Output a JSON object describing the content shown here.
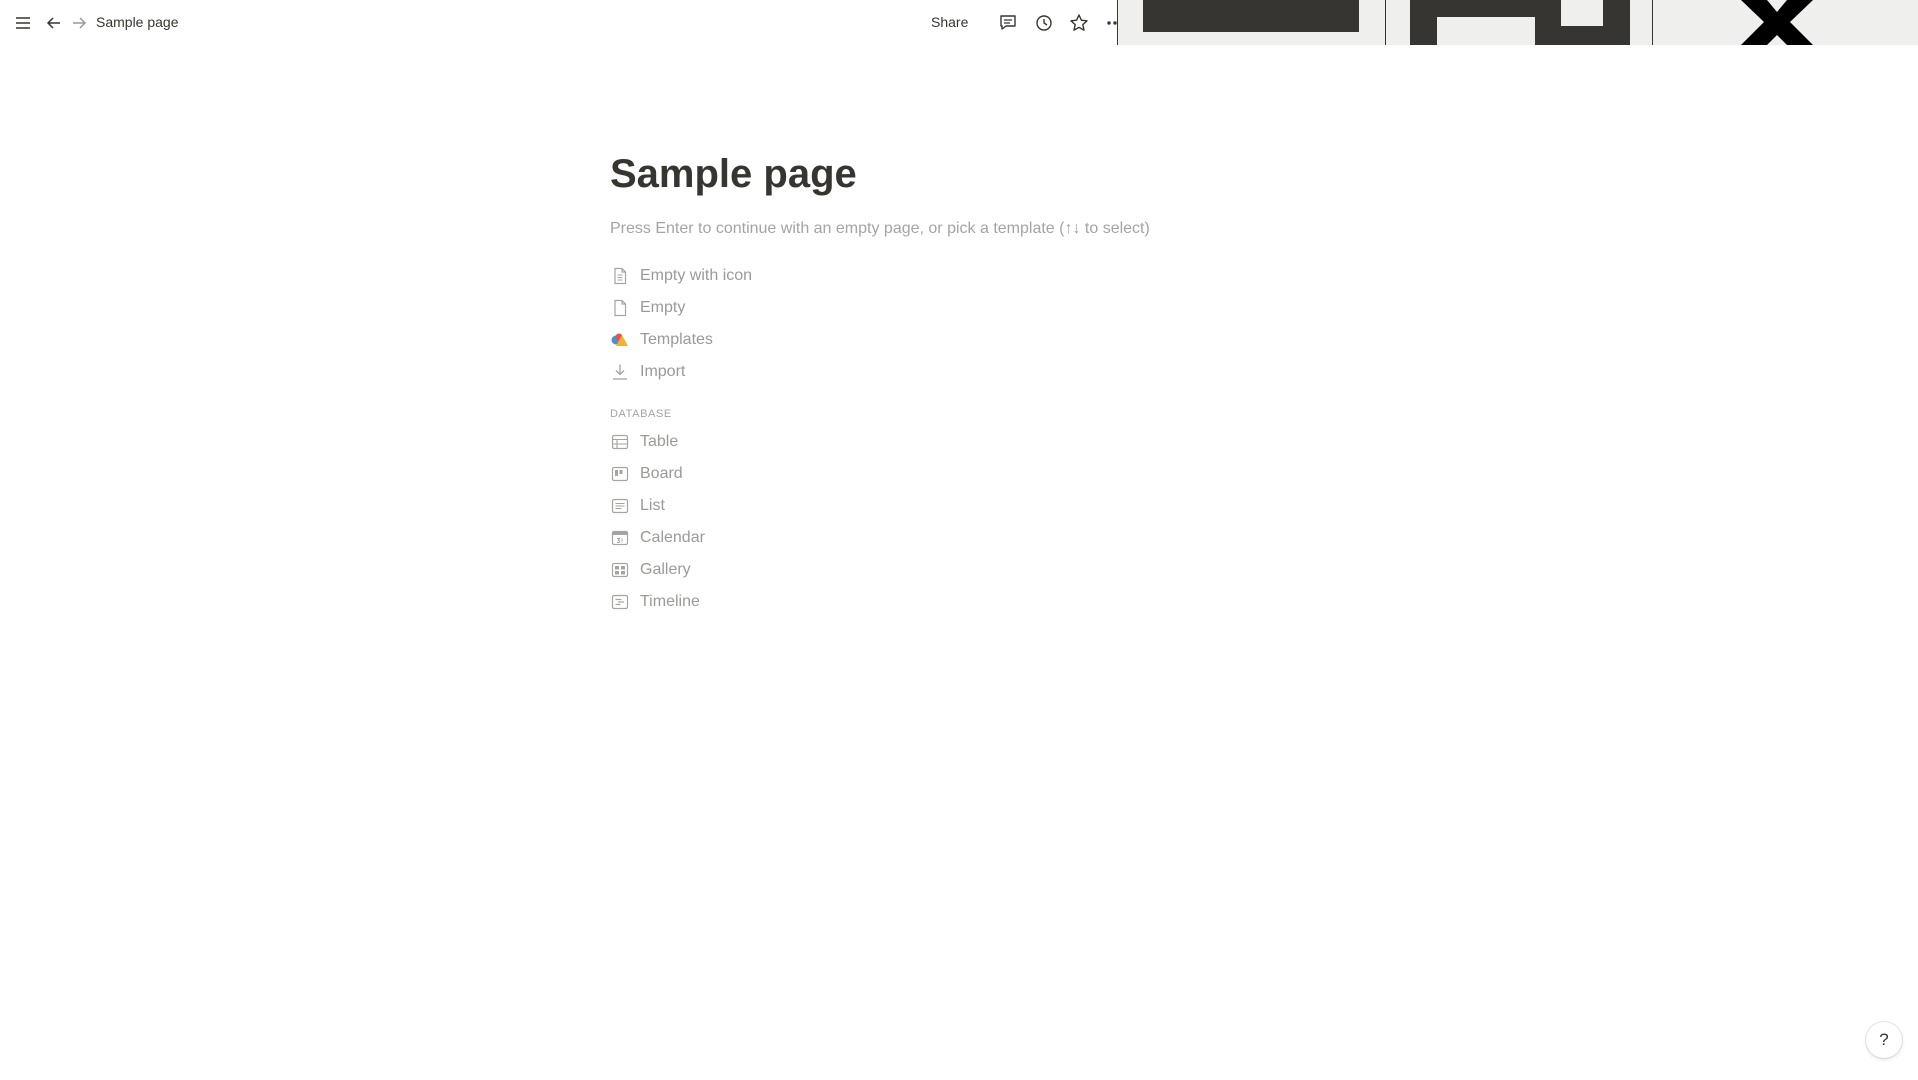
{
  "topbar": {
    "breadcrumb": "Sample page",
    "share_label": "Share",
    "icons": [
      "menu-icon",
      "back-arrow-icon",
      "forward-arrow-icon",
      "comment-icon",
      "history-icon",
      "star-icon",
      "more-icon"
    ]
  },
  "page": {
    "title": "Sample page",
    "hint": "Press Enter to continue with an empty page, or pick a template (↑↓ to select)"
  },
  "options": [
    {
      "label": "Empty with icon",
      "icon": "page-with-icon-icon"
    },
    {
      "label": "Empty",
      "icon": "empty-page-icon"
    },
    {
      "label": "Templates",
      "icon": "templates-icon"
    },
    {
      "label": "Import",
      "icon": "import-icon"
    }
  ],
  "database": {
    "section_label": "DATABASE",
    "items": [
      {
        "label": "Table",
        "icon": "table-icon"
      },
      {
        "label": "Board",
        "icon": "board-icon"
      },
      {
        "label": "List",
        "icon": "list-icon"
      },
      {
        "label": "Calendar",
        "icon": "calendar-icon"
      },
      {
        "label": "Gallery",
        "icon": "gallery-icon"
      },
      {
        "label": "Timeline",
        "icon": "timeline-icon"
      }
    ]
  },
  "help": {
    "label": "?"
  },
  "colors": {
    "text": "#37352f",
    "muted": "#9b9a97",
    "cover_bg": "#efefed"
  }
}
